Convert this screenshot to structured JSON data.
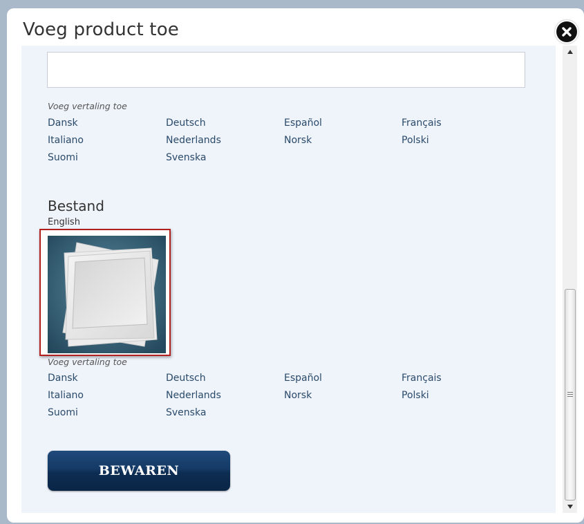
{
  "dialog": {
    "title": "Voeg product toe"
  },
  "translation_block_1": {
    "label": "Voeg vertaling toe",
    "languages": [
      "Dansk",
      "Deutsch",
      "Español",
      "Français",
      "Italiano",
      "Nederlands",
      "Norsk",
      "Polski",
      "Suomi",
      "Svenska"
    ]
  },
  "file_section": {
    "title": "Bestand",
    "language": "English"
  },
  "translation_block_2": {
    "label": "Voeg vertaling toe",
    "languages": [
      "Dansk",
      "Deutsch",
      "Español",
      "Français",
      "Italiano",
      "Nederlands",
      "Norsk",
      "Polski",
      "Suomi",
      "Svenska"
    ]
  },
  "save_button": {
    "label": "BEWAREN"
  },
  "icons": {
    "close": "close-icon",
    "scroll_up": "arrow-up-icon",
    "scroll_down": "arrow-down-icon",
    "image_placeholder": "image-placeholder-icon"
  },
  "colors": {
    "accent": "#0d2d52",
    "link": "#2a4a6a",
    "selection_border": "#b21e1e",
    "content_bg": "#eff3fa"
  }
}
